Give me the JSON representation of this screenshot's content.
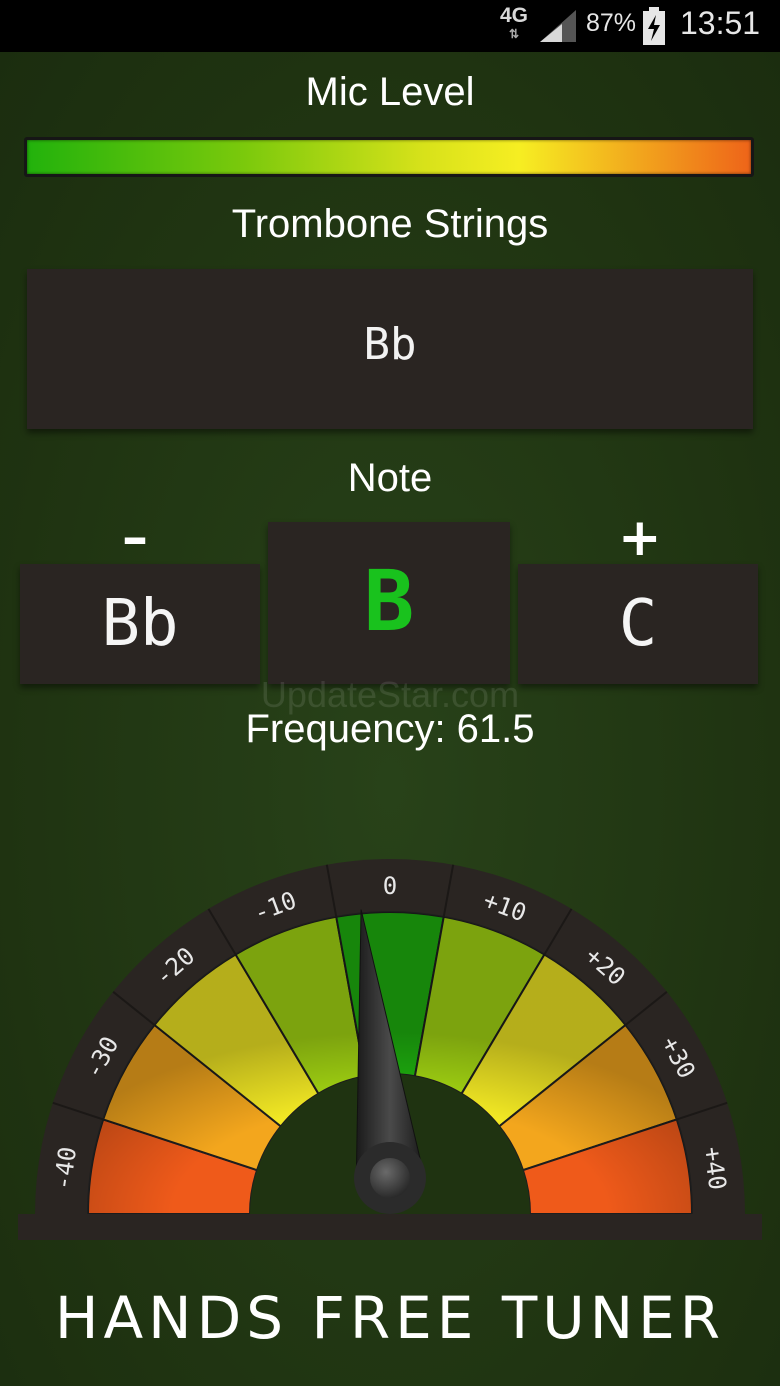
{
  "status_bar": {
    "network": "4G",
    "battery_percent": "87%",
    "time": "13:51"
  },
  "mic_level": {
    "label": "Mic Level",
    "level_fraction": 1.0
  },
  "strings": {
    "label": "Trombone Strings",
    "selected": "Bb"
  },
  "note": {
    "label": "Note",
    "minus_symbol": "–",
    "plus_symbol": "+",
    "previous": "Bb",
    "current": "B",
    "next": "C"
  },
  "watermark": "UpdateStar.com",
  "frequency": {
    "text": "Frequency: 61.5"
  },
  "gauge": {
    "ticks": [
      "-40",
      "-30",
      "-20",
      "-10",
      "0",
      "+10",
      "+20",
      "+30",
      "+40"
    ],
    "needle_cents": -3,
    "colors": {
      "center": "#1fb30f",
      "near": "#a6d913",
      "mid": "#f2e824",
      "far": "#f3a61d",
      "edge": "#ef5a1a"
    }
  },
  "brand": "HANDS FREE TUNER"
}
